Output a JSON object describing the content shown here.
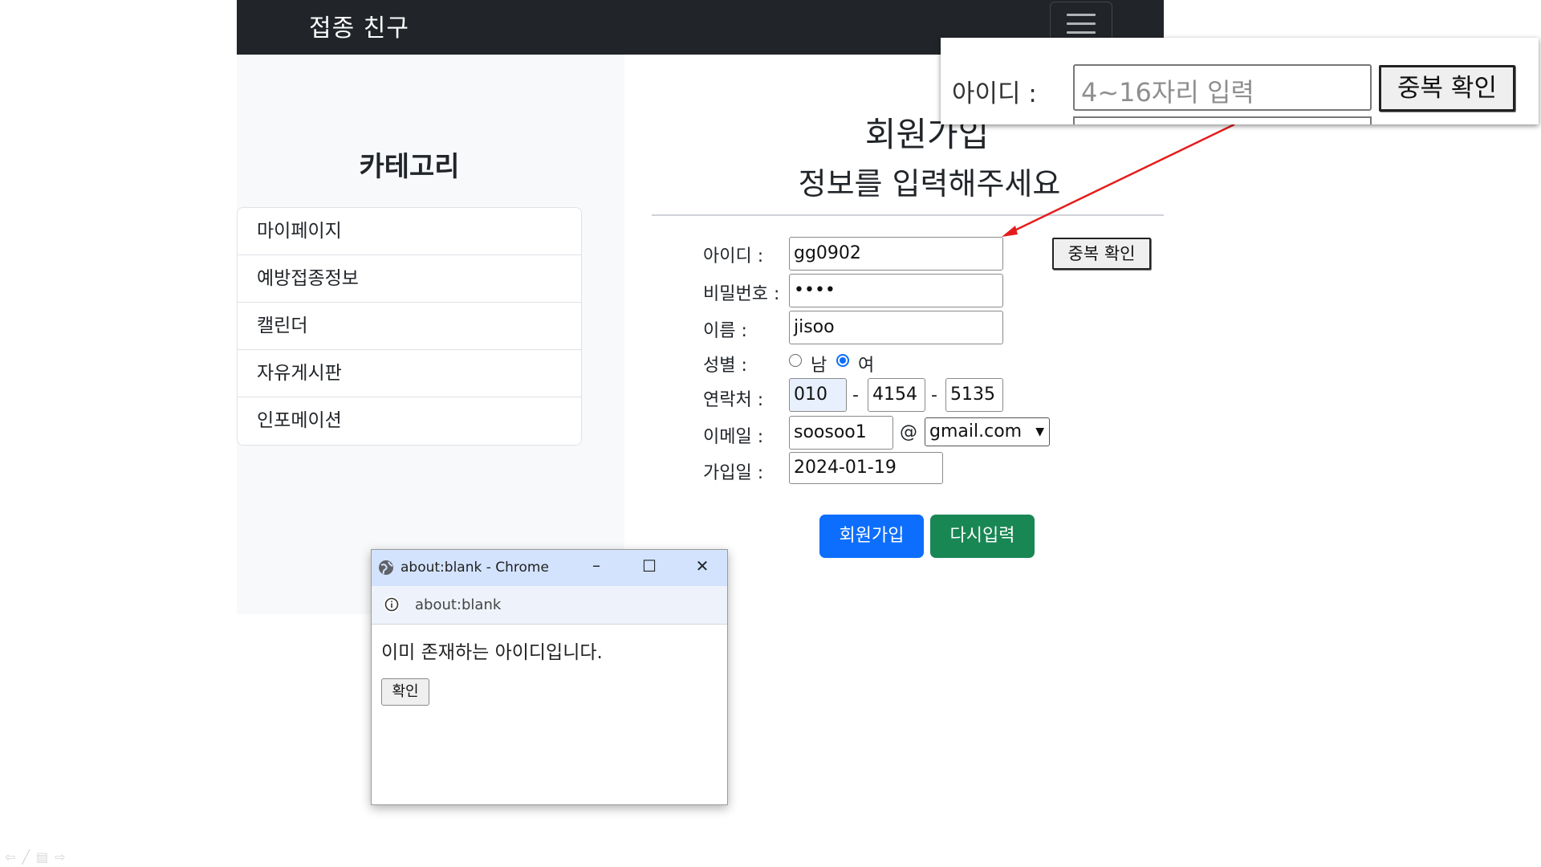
{
  "navbar": {
    "brand": "접종 친구"
  },
  "sidebar": {
    "title": "카테고리",
    "items": [
      {
        "label": "마이페이지"
      },
      {
        "label": "예방접종정보"
      },
      {
        "label": "캘린더"
      },
      {
        "label": "자유게시판"
      },
      {
        "label": "인포메이션"
      }
    ]
  },
  "main": {
    "title": "회원가입",
    "subtitle": "정보를 입력해주세요",
    "form": {
      "id_label": "아이디 :",
      "id_value": "gg0902",
      "dup_check_label": "중복 확인",
      "pw_label": "비밀번호 :",
      "pw_value": "••••",
      "name_label": "이름 :",
      "name_value": "jisoo",
      "gender_label": "성별 :",
      "gender_male": "남",
      "gender_female": "여",
      "gender_selected": "여",
      "phone_label": "연락처 :",
      "phone": [
        "010",
        "4154",
        "5135"
      ],
      "phone_sep": "-",
      "email_label": "이메일 :",
      "email_user": "soosoo1",
      "email_at": "@",
      "email_domain": "gmail.com",
      "join_date_label": "가입일 :",
      "join_date": "2024-01-19",
      "submit_label": "회원가입",
      "reset_label": "다시입력"
    }
  },
  "zoom_callout": {
    "label": "아이디 :",
    "placeholder": "4~16자리 입력",
    "button": "중복 확인"
  },
  "popup": {
    "window_title": "about:blank - Chrome",
    "url": "about:blank",
    "message": "이미 존재하는 아이디입니다.",
    "ok_label": "확인",
    "minimize": "–",
    "maximize": "☐",
    "close": "✕"
  },
  "colors": {
    "navbar": "#212529",
    "primary": "#0d6efd",
    "success": "#198754",
    "sidebar_bg": "#f8f9fa",
    "arrow": "#e51c1c"
  }
}
